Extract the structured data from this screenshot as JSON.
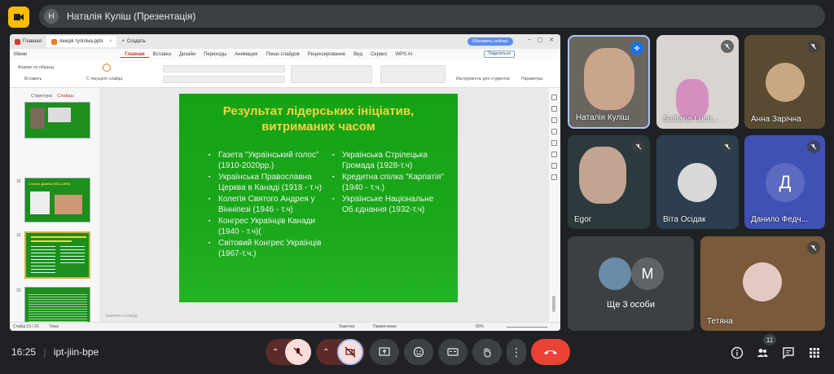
{
  "meet": {
    "presenter_avatar": "Н",
    "presenter_label": "Наталія Куліш (Презентація)",
    "time": "16:25",
    "meeting_code": "ipt-jiin-bpe",
    "participants_count": "11"
  },
  "wps": {
    "tabs": [
      "Главная",
      "лекція тупіліна.pptx",
      "Создать"
    ],
    "update_button": "Обновить сейчас",
    "menu": [
      "Меню",
      "Главная",
      "Вставка",
      "Дизайн",
      "Переходы",
      "Анимация",
      "Показ слайдов",
      "Рецензирование",
      "Вид",
      "Сервис",
      "WPS AI"
    ],
    "share": "Поделиться",
    "ribbon": {
      "format_painter": "Формат по образцу",
      "paste": "Вставить",
      "from_current": "С текущего слайда",
      "student_tools": "Инструменты для студентов",
      "params": "Параметры"
    },
    "side_tabs": [
      "Структура",
      "Слайды"
    ],
    "thumb_numbers": [
      "18",
      "19",
      "20"
    ],
    "thumb18_title": "Степан Домба (1914-1995)",
    "notes_placeholder": "Заметки к слайду",
    "status": {
      "slide": "Слайд 19 / 20",
      "theme": "Тема",
      "notes": "Заметки",
      "comments": "Примечание",
      "zoom": "80%"
    }
  },
  "slide": {
    "title_line1": "Результат лідерських ініціатив,",
    "title_line2": "витриманих часом",
    "left_items": [
      "Газета \"Український голос\" (1910-2020рр.)",
      "Українська Православна Церква в Канаді (1918 - т.ч)",
      "Колегія Святого Андрея у Вінніпезі (1946 - т.ч)",
      "Конгрес Українців Канади (1940 - т.ч)(",
      "Світовий Конгрес Українців (1967-т.ч.)"
    ],
    "right_items": [
      "Українська Стрілецька Громада (1928-т.ч)",
      "Кредитна спілка \"Карпатія\" (1940 - т.ч.)",
      "Українське Національне Об.єднання (1932-т.ч)"
    ]
  },
  "tiles": {
    "t1": "Наталія Куліш",
    "t2": "Svitlana Luch...",
    "t3": "Анна Зарічна",
    "t4": "Egor",
    "t5": "Віта Осідак",
    "t6": "Данило Федч...",
    "t6_initial": "Д",
    "more_initial": "М",
    "more_label": "Ще 3 особи",
    "t8": "Тетяна"
  },
  "colors": {
    "accent_red": "#ea4335",
    "meet_yellow": "#fbbc04",
    "slide_green": "#1aa81a",
    "title_yellow": "#f5d442"
  }
}
